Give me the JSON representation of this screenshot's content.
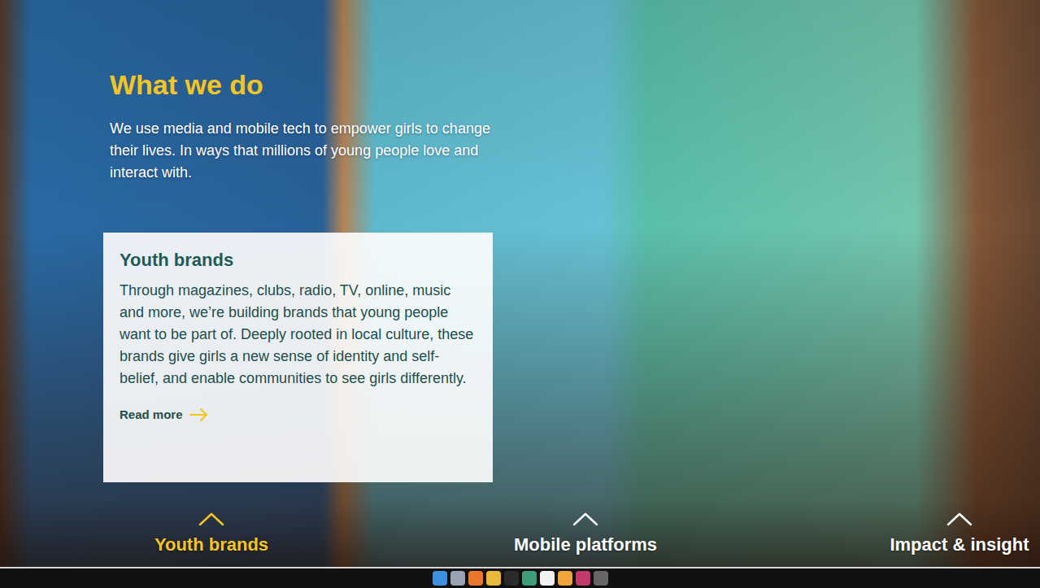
{
  "section": {
    "title": "What we do",
    "intro": "We use media and mobile tech to empower girls to change their lives. In ways that millions of young people love and interact with."
  },
  "card": {
    "title": "Youth brands",
    "body": "Through magazines, clubs, radio, TV, online, music and more, we’re building brands that young people want to be part of. Deeply rooted in local culture, these brands give girls a new sense of identity and self-belief, and enable communities to see girls differently.",
    "link": "Read more"
  },
  "tabs": [
    {
      "label": "Youth brands",
      "selected": true
    },
    {
      "label": "Mobile platforms",
      "selected": false
    },
    {
      "label": "Impact & insight",
      "selected": false
    }
  ]
}
